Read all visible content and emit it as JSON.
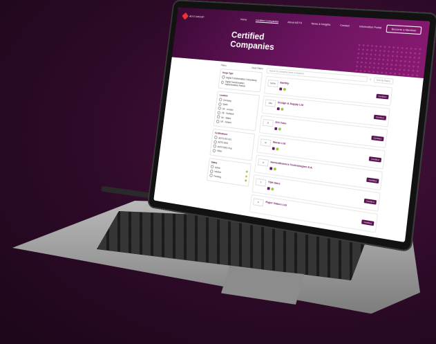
{
  "site": {
    "logo_text": "AD'O GROUP",
    "nav": [
      "Home",
      "Certified Companies",
      "About ADTS",
      "News & Insights",
      "Contact",
      "Information Portal"
    ],
    "nav_active": "Certified Companies",
    "cta": "Become a Member",
    "hero_title": "Certified Companies"
  },
  "filters": {
    "header_label": "Filters",
    "clear_label": "Clear Filters",
    "groups": [
      {
        "title": "Scope Type",
        "options": [
          "Digital Transformation Consultancy",
          "Digital Transformation Implementation Partner"
        ]
      },
      {
        "title": "Location",
        "options": [
          "Germany",
          "Spain",
          "UK - London",
          "UK - Scotland",
          "UK - Wales",
          "UK - Ireland"
        ]
      },
      {
        "title": "Certifications",
        "options": [
          "ADTS ISO 001",
          "ADTS 9001",
          "ADTS 9001 Plus",
          "Other"
        ]
      },
      {
        "title": "Status",
        "options": [
          "Active",
          "Inactive",
          "Pending"
        ]
      }
    ]
  },
  "search": {
    "placeholder": "Search by company name or keyword",
    "sort": "Sort by Name"
  },
  "companies": [
    {
      "name": "Earthly",
      "logo": "SATIN",
      "badge": "Certified"
    },
    {
      "name": "Design & Supply Ltd",
      "logo": "DSL",
      "badge": "Certified"
    },
    {
      "name": "DVI Tube",
      "logo": "D",
      "badge": "Certified"
    },
    {
      "name": "Moran Ltd",
      "logo": "M",
      "badge": "Certified"
    },
    {
      "name": "Homesfleaners Technologies S.A.",
      "logo": "H",
      "badge": "Certified"
    },
    {
      "name": "TSH Sites",
      "logo": "T",
      "badge": "Certified"
    },
    {
      "name": "Paper Galore Ltd",
      "logo": "P",
      "badge": "Certified"
    }
  ],
  "colors": {
    "brand": "#6b1460",
    "accent_green": "#9bc53d",
    "hero_dark": "#3b0a35"
  }
}
